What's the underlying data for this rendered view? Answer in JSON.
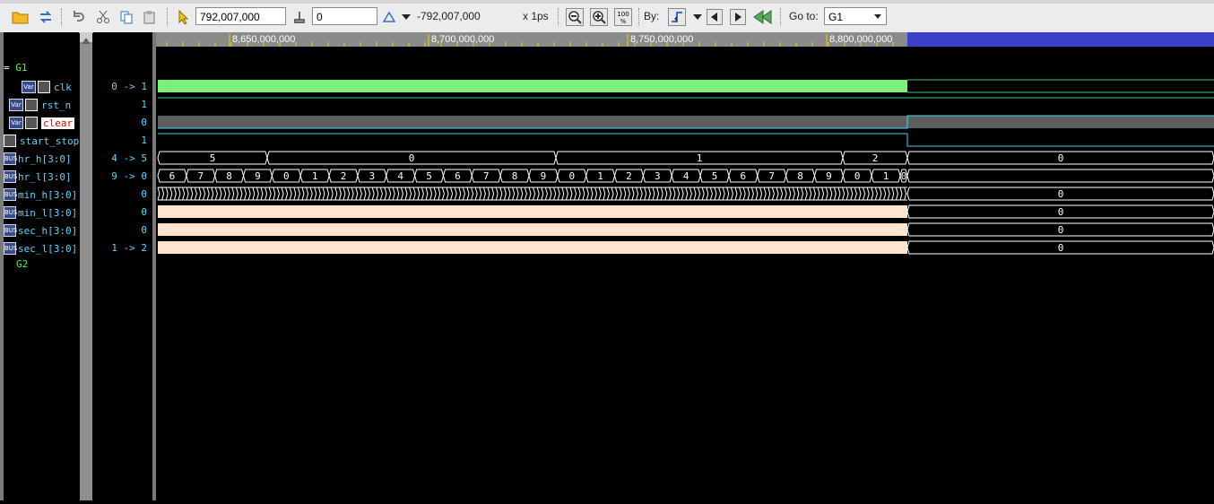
{
  "toolbar": {
    "time_value": "792,007,000",
    "offset_value": "0",
    "delta_label": "-792,007,000",
    "scale_label": "x 1ps",
    "by_label": "By:",
    "goto_label": "Go to:",
    "goto_value": "G1"
  },
  "timeline": {
    "ticks": [
      "8,650,000,000",
      "8,700,000,000",
      "8,750,000,000",
      "8,800,000,000"
    ]
  },
  "groups": [
    "G1",
    "G2"
  ],
  "signals": [
    {
      "name": "clk",
      "value": "0 -> 1",
      "type": "Var"
    },
    {
      "name": "rst_n",
      "value": "1",
      "type": "Var"
    },
    {
      "name": "clear",
      "value": "0",
      "type": "Var"
    },
    {
      "name": "start_stop",
      "value": "1",
      "type": "Var"
    },
    {
      "name": "hr_h[3:0]",
      "value": "4 -> 5",
      "type": "Bus"
    },
    {
      "name": "hr_l[3:0]",
      "value": "9 -> 0",
      "type": "Bus"
    },
    {
      "name": "min_h[3:0]",
      "value": "0",
      "type": "Bus"
    },
    {
      "name": "min_l[3:0]",
      "value": "0",
      "type": "Bus"
    },
    {
      "name": "sec_h[3:0]",
      "value": "0",
      "type": "Bus"
    },
    {
      "name": "sec_l[3:0]",
      "value": "1 -> 2",
      "type": "Bus"
    }
  ],
  "waves": {
    "hr_h_segments": [
      "5",
      "0",
      "1",
      "2",
      "0"
    ],
    "hr_l_segments": [
      "6",
      "7",
      "8",
      "9",
      "0",
      "1",
      "2",
      "3",
      "4",
      "5",
      "6",
      "7",
      "8",
      "9",
      "0",
      "1",
      "2",
      "3",
      "4",
      "5",
      "6",
      "7",
      "8",
      "9",
      "0",
      "1",
      "0"
    ],
    "min_h_end": "0",
    "min_l_end": "0",
    "sec_h_end": "0",
    "sec_l_end": "0"
  },
  "colors": {
    "clk_fill": "#7af07a",
    "bus_line": "#46d6e8",
    "trace_green": "#3ccf6a",
    "clear_fill": "#5e5e5e",
    "dense_fill": "#ffe4cf",
    "cursor_bar": "#3a40c8"
  }
}
